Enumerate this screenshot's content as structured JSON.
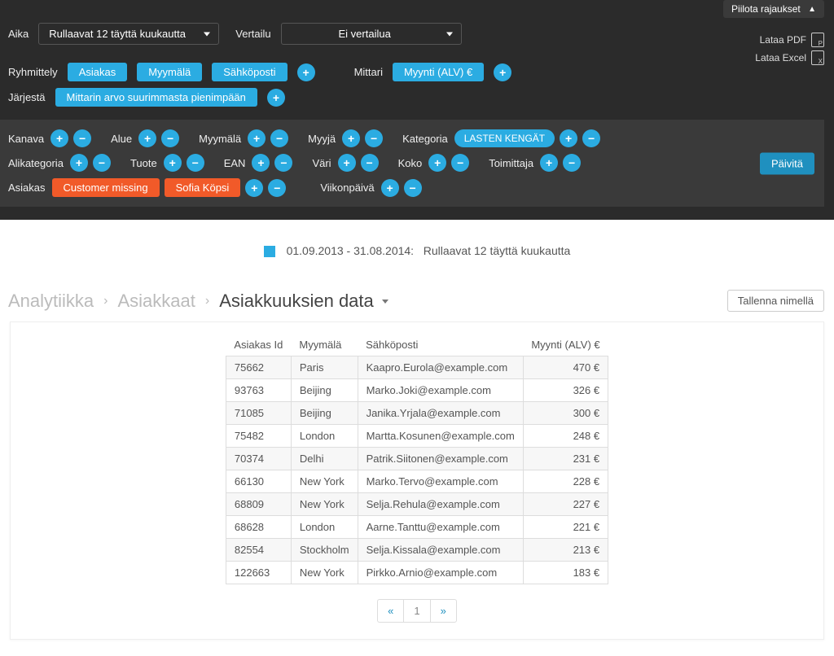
{
  "header": {
    "hide_filters": "Piilota rajaukset",
    "download_pdf": "Lataa PDF",
    "download_excel": "Lataa Excel"
  },
  "time": {
    "label": "Aika",
    "selected": "Rullaavat 12 täyttä kuukautta"
  },
  "compare": {
    "label": "Vertailu",
    "selected": "Ei vertailua"
  },
  "grouping": {
    "label": "Ryhmittely",
    "items": [
      "Asiakas",
      "Myymälä",
      "Sähköposti"
    ],
    "metric_label": "Mittari",
    "metric_value": "Myynti (ALV) €"
  },
  "order": {
    "label": "Järjestä",
    "value": "Mittarin arvo suurimmasta pienimpään"
  },
  "filters": {
    "kanava": "Kanava",
    "alue": "Alue",
    "myymala": "Myymälä",
    "myyja": "Myyjä",
    "kategoria": "Kategoria",
    "kategoria_value": "LASTEN KENGÄT",
    "alikategoria": "Alikategoria",
    "tuote": "Tuote",
    "ean": "EAN",
    "vari": "Väri",
    "koko": "Koko",
    "toimittaja": "Toimittaja",
    "asiakas": "Asiakas",
    "asiakas_values": [
      "Customer missing",
      "Sofia Köpsi"
    ],
    "viikonpaiva": "Viikonpäivä",
    "update": "Päivitä"
  },
  "date_range": {
    "range": "01.09.2013 - 31.08.2014:",
    "desc": "Rullaavat 12 täyttä kuukautta"
  },
  "breadcrumb": {
    "a": "Analytiikka",
    "b": "Asiakkaat",
    "c": "Asiakkuuksien data"
  },
  "save_as": "Tallenna nimellä",
  "table": {
    "headers": {
      "id": "Asiakas Id",
      "store": "Myymälä",
      "email": "Sähköposti",
      "sales": "Myynti (ALV) €"
    },
    "rows": [
      {
        "id": "75662",
        "store": "Paris",
        "email": "Kaapro.Eurola@example.com",
        "sales": "470 €"
      },
      {
        "id": "93763",
        "store": "Beijing",
        "email": "Marko.Joki@example.com",
        "sales": "326 €"
      },
      {
        "id": "71085",
        "store": "Beijing",
        "email": "Janika.Yrjala@example.com",
        "sales": "300 €"
      },
      {
        "id": "75482",
        "store": "London",
        "email": "Martta.Kosunen@example.com",
        "sales": "248 €"
      },
      {
        "id": "70374",
        "store": "Delhi",
        "email": "Patrik.Siitonen@example.com",
        "sales": "231 €"
      },
      {
        "id": "66130",
        "store": "New York",
        "email": "Marko.Tervo@example.com",
        "sales": "228 €"
      },
      {
        "id": "68809",
        "store": "New York",
        "email": "Selja.Rehula@example.com",
        "sales": "227 €"
      },
      {
        "id": "68628",
        "store": "London",
        "email": "Aarne.Tanttu@example.com",
        "sales": "221 €"
      },
      {
        "id": "82554",
        "store": "Stockholm",
        "email": "Selja.Kissala@example.com",
        "sales": "213 €"
      },
      {
        "id": "122663",
        "store": "New York",
        "email": "Pirkko.Arnio@example.com",
        "sales": "183 €"
      }
    ]
  },
  "pager": {
    "prev": "«",
    "current": "1",
    "next": "»"
  }
}
